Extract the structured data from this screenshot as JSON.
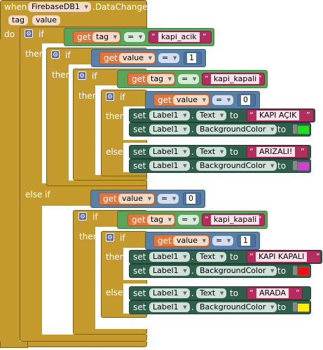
{
  "event": {
    "when": "when",
    "component": "FirebaseDB1",
    "event_name": ".DataChanged",
    "params": [
      "tag",
      "value"
    ],
    "do": "do"
  },
  "kw": {
    "if": "if",
    "then": "then",
    "else": "else",
    "else_if": "else if",
    "get": "get",
    "set": "set",
    "to": "to",
    "dot": ".",
    "eq": "=",
    "open_q": "“",
    "close_q": "”"
  },
  "blocks": {
    "cond1": {
      "var": "tag",
      "text": "kapi_acik"
    },
    "cond2": {
      "var": "value",
      "num": "1"
    },
    "cond3": {
      "var": "tag",
      "text": "kapi_kapali"
    },
    "cond4": {
      "var": "value",
      "num": "0"
    },
    "set_acik_text": {
      "comp": "Label1",
      "prop": "Text",
      "text": "KAPI AÇIK"
    },
    "set_acik_bg": {
      "comp": "Label1",
      "prop": "BackgroundColor",
      "color": "#22dd22"
    },
    "set_arizali_text": {
      "comp": "Label1",
      "prop": "Text",
      "text": "ARIZALI!"
    },
    "set_arizali_bg": {
      "comp": "Label1",
      "prop": "BackgroundColor",
      "color": "#cc44cc"
    },
    "cond5": {
      "var": "value",
      "num": "0"
    },
    "cond6": {
      "var": "tag",
      "text": "kapi_kapali"
    },
    "cond7": {
      "var": "value",
      "num": "1"
    },
    "set_kapali_text": {
      "comp": "Label1",
      "prop": "Text",
      "text": "KAPI KAPALI"
    },
    "set_kapali_bg": {
      "comp": "Label1",
      "prop": "BackgroundColor",
      "color": "#ee1111"
    },
    "set_arada_text": {
      "comp": "Label1",
      "prop": "Text",
      "text": "ARADA"
    },
    "set_arada_bg": {
      "comp": "Label1",
      "prop": "BackgroundColor",
      "color": "#ffee00"
    }
  },
  "colors": {
    "event_block": "#c49a2c",
    "control_block": "#c49a2c",
    "logic_block": "#5ba55b",
    "math_block": "#5b80a5",
    "variable_block": "#e0763b",
    "setter_block": "#2f5f4a",
    "text_block": "#b32d5e"
  }
}
